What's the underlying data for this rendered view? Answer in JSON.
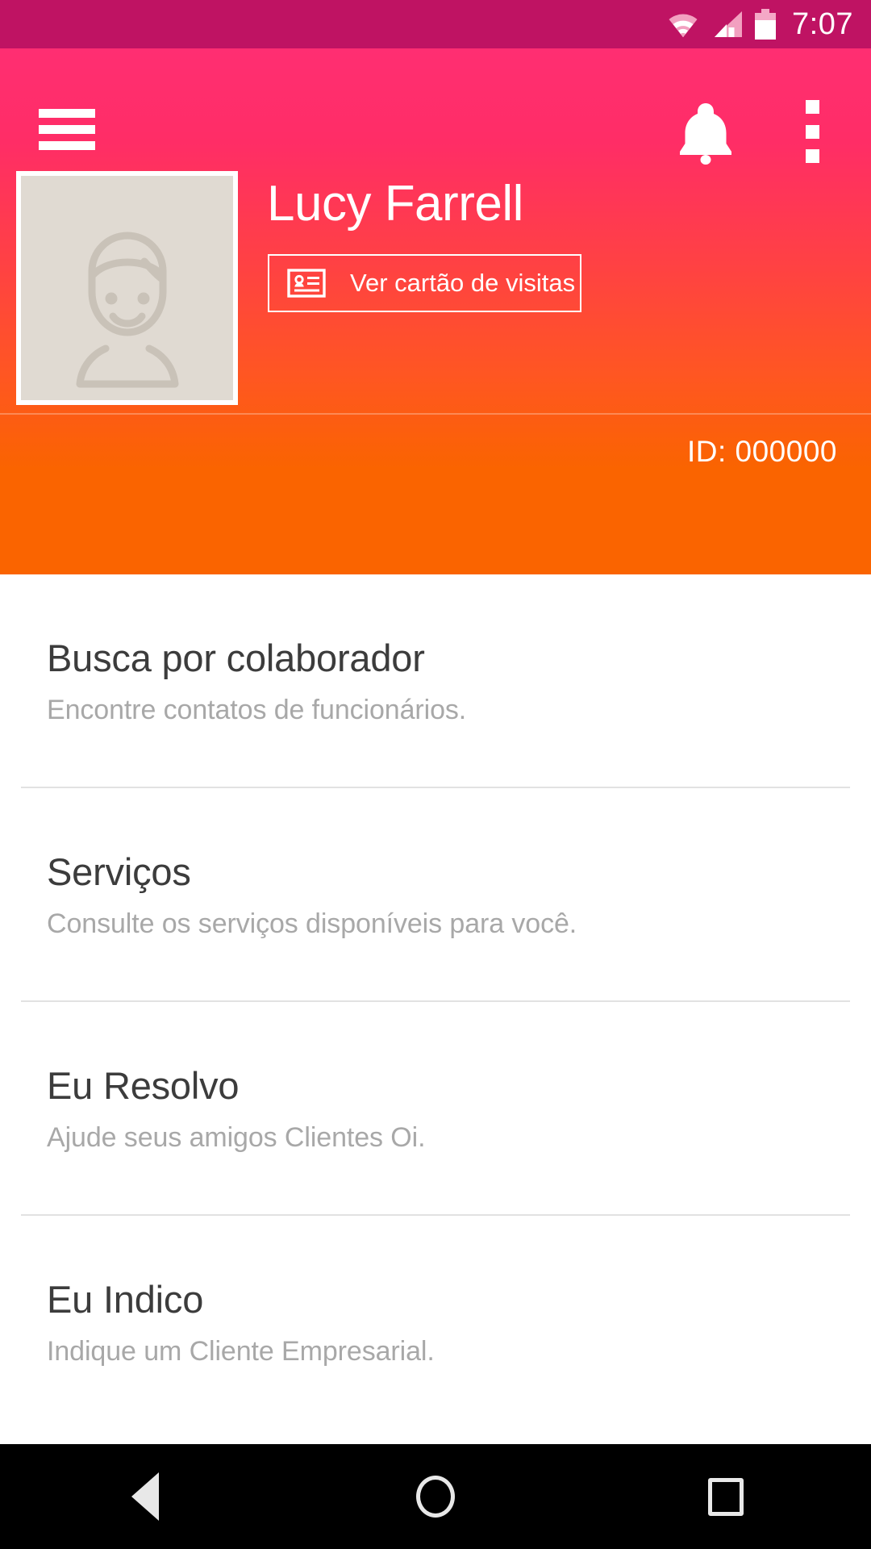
{
  "status_bar": {
    "time": "7:07",
    "icons": [
      "wifi-icon",
      "signal-icon",
      "battery-icon"
    ]
  },
  "app_bar": {
    "menu_icon": "hamburger-menu-icon",
    "notification_icon": "bell-icon",
    "overflow_icon": "overflow-menu-icon"
  },
  "profile": {
    "avatar_placeholder_icon": "person-placeholder-icon",
    "name": "Lucy Farrell",
    "card_button_label": "Ver cartão de visitas",
    "card_button_icon": "contact-card-icon",
    "id_label": "ID: 000000"
  },
  "colors": {
    "status_bar": "#bf1363",
    "gradient_top": "#ff2e72",
    "gradient_bottom": "#fa6400",
    "list_title": "#3c3c3c",
    "list_subtitle": "#a8a8a8",
    "divider": "#e2e2e2",
    "nav_bar": "#000000",
    "avatar_bg": "#e0dad2"
  },
  "list": {
    "items": [
      {
        "title": "Busca por colaborador",
        "subtitle": "Encontre contatos de funcionários."
      },
      {
        "title": "Serviços",
        "subtitle": "Consulte os serviços disponíveis para você."
      },
      {
        "title": "Eu Resolvo",
        "subtitle": "Ajude seus amigos Clientes Oi."
      },
      {
        "title": "Eu Indico",
        "subtitle": "Indique um Cliente Empresarial."
      }
    ]
  },
  "nav_bar": {
    "back_label": "back-icon",
    "home_label": "home-icon",
    "recents_label": "recents-icon"
  }
}
